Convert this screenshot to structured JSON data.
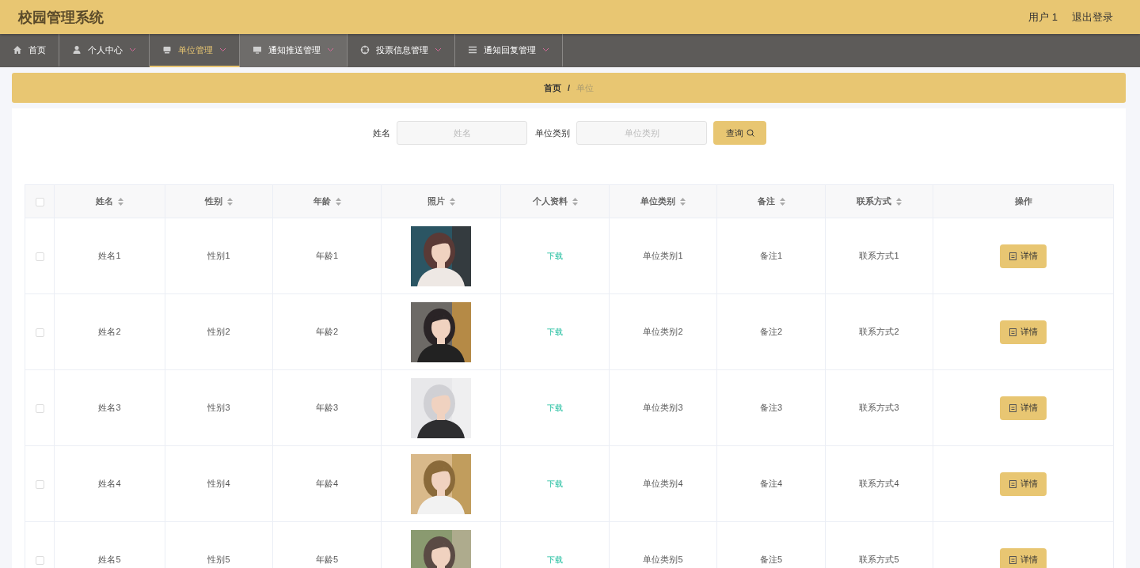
{
  "header": {
    "title": "校园管理系统",
    "user": "用户 1",
    "logout": "退出登录"
  },
  "nav": [
    {
      "label": "首页",
      "selected": false,
      "highlighted": false,
      "has_menu": false
    },
    {
      "label": "个人中心",
      "selected": false,
      "highlighted": false,
      "has_menu": true
    },
    {
      "label": "单位管理",
      "selected": true,
      "highlighted": false,
      "has_menu": true
    },
    {
      "label": "通知推送管理",
      "selected": false,
      "highlighted": true,
      "has_menu": true
    },
    {
      "label": "投票信息管理",
      "selected": false,
      "highlighted": false,
      "has_menu": true
    },
    {
      "label": "通知回复管理",
      "selected": false,
      "highlighted": false,
      "has_menu": true
    }
  ],
  "breadcrumb": {
    "items": [
      "首页",
      "单位"
    ],
    "separator": "/"
  },
  "search": {
    "fields": [
      {
        "label": "姓名",
        "placeholder": "姓名"
      },
      {
        "label": "单位类别",
        "placeholder": "单位类别"
      }
    ],
    "button": "查询"
  },
  "table": {
    "select_all": {
      "checked": false
    },
    "columns": [
      {
        "label": "姓名",
        "sortable": true
      },
      {
        "label": "性别",
        "sortable": true
      },
      {
        "label": "年龄",
        "sortable": true
      },
      {
        "label": "照片",
        "sortable": true
      },
      {
        "label": "个人资料",
        "sortable": true
      },
      {
        "label": "单位类别",
        "sortable": true
      },
      {
        "label": "备注",
        "sortable": true
      },
      {
        "label": "联系方式",
        "sortable": true
      },
      {
        "label": "操作",
        "sortable": false
      }
    ],
    "rows": [
      {
        "checked": false,
        "name": "姓名1",
        "gender": "性别1",
        "age": "年龄1",
        "file": "下载",
        "category": "单位类别1",
        "note": "备注1",
        "contact": "联系方式1",
        "action": "详情"
      },
      {
        "checked": false,
        "name": "姓名2",
        "gender": "性别2",
        "age": "年龄2",
        "file": "下载",
        "category": "单位类别2",
        "note": "备注2",
        "contact": "联系方式2",
        "action": "详情"
      },
      {
        "checked": false,
        "name": "姓名3",
        "gender": "性别3",
        "age": "年龄3",
        "file": "下载",
        "category": "单位类别3",
        "note": "备注3",
        "contact": "联系方式3",
        "action": "详情"
      },
      {
        "checked": false,
        "name": "姓名4",
        "gender": "性别4",
        "age": "年龄4",
        "file": "下载",
        "category": "单位类别4",
        "note": "备注4",
        "contact": "联系方式4",
        "action": "详情"
      },
      {
        "checked": false,
        "name": "姓名5",
        "gender": "性别5",
        "age": "年龄5",
        "file": "下载",
        "category": "单位类别5",
        "note": "备注5",
        "contact": "联系方式5",
        "action": "详情"
      }
    ]
  }
}
